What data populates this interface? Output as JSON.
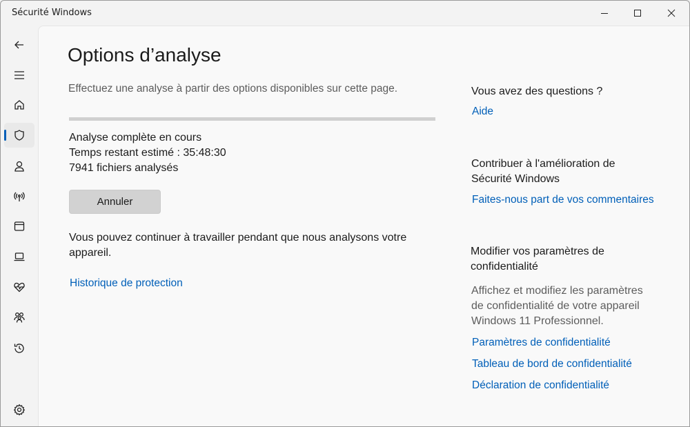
{
  "window": {
    "title": "Sécurité Windows"
  },
  "titlebar_buttons": [
    {
      "name": "minimize",
      "icon": "minimize-icon"
    },
    {
      "name": "maximize",
      "icon": "maximize-icon"
    },
    {
      "name": "close",
      "icon": "close-icon"
    }
  ],
  "nav": {
    "items": [
      {
        "icon": "back-arrow-icon",
        "active": false
      },
      {
        "icon": "hamburger-menu-icon",
        "active": false
      },
      {
        "icon": "home-icon",
        "active": false
      },
      {
        "icon": "shield-icon",
        "active": true
      },
      {
        "icon": "person-icon",
        "active": false
      },
      {
        "icon": "wireless-antenna-icon",
        "active": false
      },
      {
        "icon": "app-browser-icon",
        "active": false
      },
      {
        "icon": "laptop-icon",
        "active": false
      },
      {
        "icon": "heart-pulse-icon",
        "active": false
      },
      {
        "icon": "family-icon",
        "active": false
      },
      {
        "icon": "history-icon",
        "active": false
      },
      {
        "icon": "settings-gear-icon",
        "active": false
      }
    ],
    "accent_color": "#005fb8"
  },
  "main": {
    "title": "Options d’analyse",
    "subtitle": "Effectuez une analyse à partir des options disponibles sur cette page.",
    "progress": {
      "value_percent": 100,
      "indeterminate": true
    },
    "status": {
      "line1": "Analyse complète en cours",
      "line2": "Temps restant estimé : 35:48:30",
      "line3": "7941 fichiers analysés"
    },
    "cancel_label": "Annuler",
    "info_text": "Vous pouvez continuer à travailler pendant que nous analysons votre appareil.",
    "history_link": "Historique de protection"
  },
  "sidebar": {
    "questions_heading": "Vous avez des questions ?",
    "help_link": "Aide",
    "contribute_heading_line1": "Contribuer à l'amélioration de",
    "contribute_heading_line2": "Sécurité Windows",
    "feedback_link": "Faites-nous part de vos commentaires",
    "privacy_heading_line1": "Modifier vos paramètres de",
    "privacy_heading_line2": "confidentialité",
    "privacy_desc_line1": "Affichez et modifiez les paramètres",
    "privacy_desc_line2": "de confidentialité de votre appareil",
    "privacy_desc_line3": "Windows 11 Professionnel.",
    "privacy_links": [
      "Paramètres de confidentialité",
      "Tableau de bord de confidentialité",
      "Déclaration de confidentialité"
    ]
  }
}
